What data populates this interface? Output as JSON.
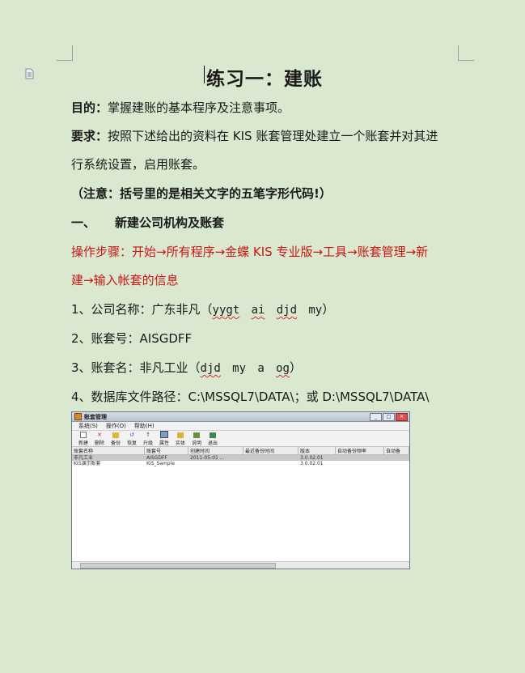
{
  "doc": {
    "title": "练习一：建账",
    "purpose_label": "目的：",
    "purpose_text": "掌握建账的基本程序及注意事项。",
    "req_label": "要求：",
    "req_text_1": "按照下述给出的资料在 KIS 账套管理处建立一个账套并对其进",
    "req_text_2": "行系统设置，启用账套。",
    "note": "（注意：括号里的是相关文字的五笔字形代码!）",
    "section_num": "一、",
    "section_title": "新建公司机构及账套",
    "steps_1": "操作步骤：开始→所有程序→金蝶 KIS 专业版→工具→账套管理→新",
    "steps_2": "建→输入帐套的信息",
    "item1_prefix": "1、公司名称：广东非凡（",
    "item1_code1": "yygt",
    "item1_code2": "ai",
    "item1_code3": "djd",
    "item1_code4": "my",
    "item1_suffix": "）",
    "item2": "2、账套号：AISGDFF",
    "item3_prefix": "3、账套名：非凡工业（",
    "item3_code1": "djd",
    "item3_code2": "my",
    "item3_code3": "a",
    "item3_code4": "og",
    "item3_suffix": "）",
    "item4": "4、数据库文件路径：C:\\MSSQL7\\DATA\\；或 D:\\MSSQL7\\DATA\\"
  },
  "window": {
    "title": "账套管理",
    "menu": [
      "系统(S)",
      "操作(O)",
      "帮助(H)"
    ],
    "toolbar": [
      "新建",
      "删除",
      "备份",
      "恢复",
      "升级",
      "属性",
      "实体",
      "说明",
      "退出"
    ],
    "columns": [
      "账套名称",
      "账套号",
      "创建时间",
      "最近备份时间",
      "版本",
      "自动备份频率",
      "自动备"
    ],
    "rows": [
      [
        "非凡工业",
        "AISGDFF",
        "2011-05-01 ...",
        "",
        "3.0.02.01",
        "",
        ""
      ],
      [
        "KIS演示账套",
        "KIS_Sample",
        "",
        "",
        "3.0.02.01",
        "",
        ""
      ]
    ]
  }
}
